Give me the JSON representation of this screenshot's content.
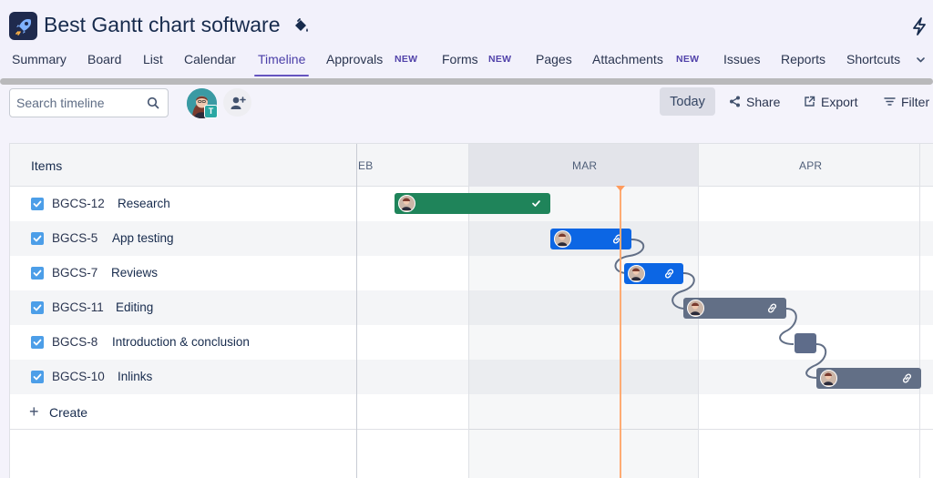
{
  "app": {
    "title": "Best Gantt chart software"
  },
  "tabs": [
    {
      "label": "Summary"
    },
    {
      "label": "Board"
    },
    {
      "label": "List"
    },
    {
      "label": "Calendar"
    },
    {
      "label": "Timeline",
      "active": true
    },
    {
      "label": "Approvals",
      "badge": "NEW"
    },
    {
      "label": "Forms",
      "badge": "NEW"
    },
    {
      "label": "Pages"
    },
    {
      "label": "Attachments",
      "badge": "NEW"
    },
    {
      "label": "Issues"
    },
    {
      "label": "Reports"
    },
    {
      "label": "Shortcuts"
    }
  ],
  "toolbar": {
    "search_placeholder": "Search timeline",
    "avatar_badge": "T",
    "today_label": "Today",
    "share_label": "Share",
    "export_label": "Export",
    "filter_label": "Filter"
  },
  "timeline": {
    "items_header": "Items",
    "months": [
      "EB",
      "MAR",
      "APR"
    ],
    "rows": [
      {
        "key": "BGCS-12",
        "name": "Research",
        "checked": true,
        "bar_color": "#1f845a",
        "bar_icon": "check-icon"
      },
      {
        "key": "BGCS-5",
        "name": "App testing",
        "checked": true,
        "bar_color": "#0c66e4",
        "bar_icon": "link-icon"
      },
      {
        "key": "BGCS-7",
        "name": "Reviews",
        "checked": true,
        "bar_color": "#0c66e4",
        "bar_icon": "link-icon"
      },
      {
        "key": "BGCS-11",
        "name": "Editing",
        "checked": true,
        "bar_color": "#626f86",
        "bar_icon": "link-icon"
      },
      {
        "key": "BGCS-8",
        "name": "Introduction & conclusion",
        "checked": true,
        "bar_color": "#626f86",
        "bar_icon": "milestone"
      },
      {
        "key": "BGCS-10",
        "name": "Inlinks",
        "checked": true,
        "bar_color": "#626f86",
        "bar_icon": "link-icon"
      }
    ],
    "create_label": "Create"
  },
  "colors": {
    "accent": "#6554c0",
    "today_line": "#ffab73",
    "checkbox": "#4c9ee8"
  }
}
